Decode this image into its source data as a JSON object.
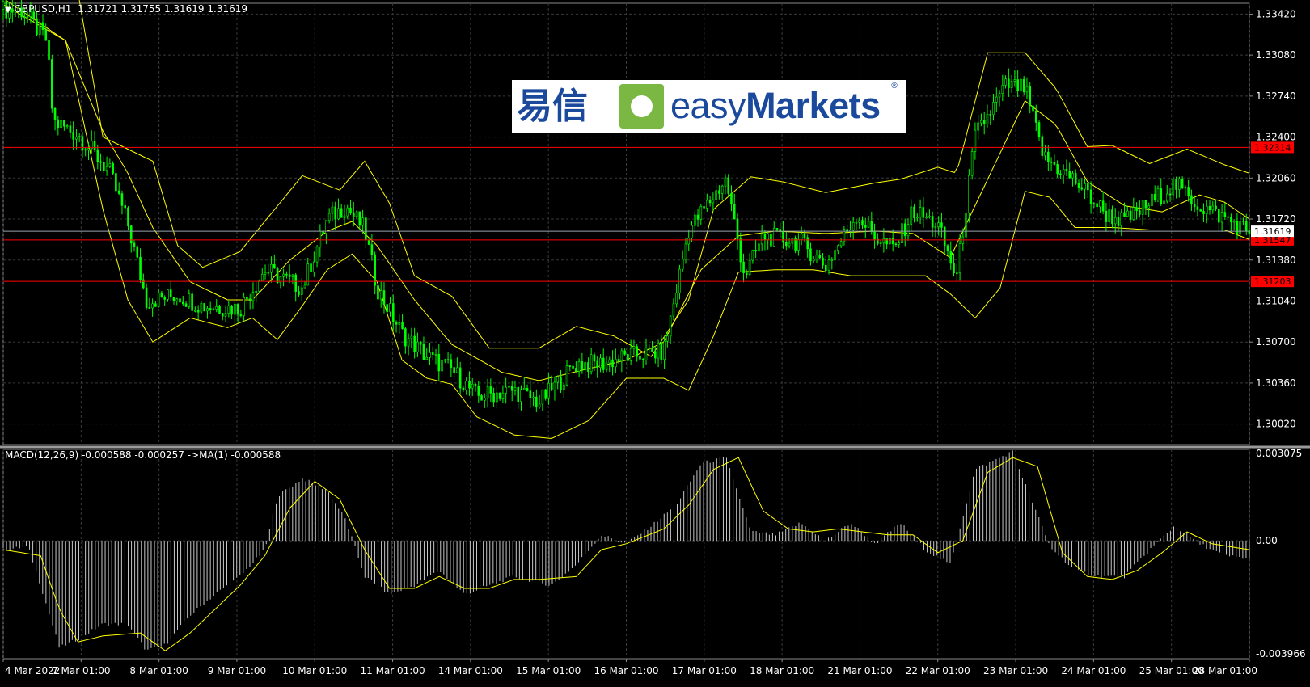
{
  "header": {
    "symbol": "GBPUSD,H1",
    "ohlc": "1.31721 1.31755 1.31619 1.31619",
    "indicator": "MACD(12,26,9) -0.000588 -0.000257  ->MA(1) -0.000588"
  },
  "logo": {
    "chinese": "易信",
    "brand_easy": "easy",
    "brand_markets": "Markets",
    "registered": "®"
  },
  "colors": {
    "background": "#000000",
    "grid": "#3a3a3a",
    "candle": "#00ff00",
    "bands": "#ffff00",
    "histogram": "#c8c8c8",
    "signal": "#ffff00",
    "level_line": "#ff0000",
    "price_tag": "#ffffff",
    "axis_text": "#ffffff"
  },
  "chart_data": [
    {
      "type": "candlestick",
      "title": "GBPUSD,H1",
      "indicators": [
        "Bollinger Bands"
      ],
      "ylim": [
        1.2985,
        1.3351
      ],
      "y_ticks": [
        "1.33420",
        "1.33080",
        "1.32740",
        "1.32400",
        "1.32060",
        "1.31720",
        "1.31380",
        "1.31040",
        "1.30700",
        "1.30360",
        "1.30020"
      ],
      "x_ticks": [
        "4 Mar 2022",
        "7 Mar 01:00",
        "8 Mar 01:00",
        "9 Mar 01:00",
        "10 Mar 01:00",
        "11 Mar 01:00",
        "14 Mar 01:00",
        "15 Mar 01:00",
        "16 Mar 01:00",
        "17 Mar 01:00",
        "18 Mar 01:00",
        "21 Mar 01:00",
        "22 Mar 01:00",
        "23 Mar 01:00",
        "24 Mar 01:00",
        "25 Mar 01:00",
        "28 Mar 01:00"
      ],
      "close_path": [
        [
          0,
          1.3346
        ],
        [
          0.015,
          1.3345
        ],
        [
          0.035,
          1.332
        ],
        [
          0.04,
          1.3253
        ],
        [
          0.06,
          1.3242
        ],
        [
          0.085,
          1.3212
        ],
        [
          0.1,
          1.3168
        ],
        [
          0.115,
          1.3104
        ],
        [
          0.14,
          1.3109
        ],
        [
          0.16,
          1.31
        ],
        [
          0.19,
          1.3098
        ],
        [
          0.21,
          1.313
        ],
        [
          0.24,
          1.3115
        ],
        [
          0.26,
          1.3172
        ],
        [
          0.275,
          1.3183
        ],
        [
          0.29,
          1.3163
        ],
        [
          0.3,
          1.3115
        ],
        [
          0.32,
          1.3077
        ],
        [
          0.34,
          1.3058
        ],
        [
          0.36,
          1.3047
        ],
        [
          0.38,
          1.3025
        ],
        [
          0.41,
          1.303
        ],
        [
          0.43,
          1.302
        ],
        [
          0.46,
          1.3052
        ],
        [
          0.48,
          1.3052
        ],
        [
          0.5,
          1.3058
        ],
        [
          0.53,
          1.3062
        ],
        [
          0.55,
          1.3163
        ],
        [
          0.58,
          1.3205
        ],
        [
          0.595,
          1.3125
        ],
        [
          0.61,
          1.3158
        ],
        [
          0.64,
          1.3153
        ],
        [
          0.66,
          1.3133
        ],
        [
          0.685,
          1.3176
        ],
        [
          0.7,
          1.3157
        ],
        [
          0.715,
          1.3147
        ],
        [
          0.73,
          1.3179
        ],
        [
          0.75,
          1.3167
        ],
        [
          0.765,
          1.3123
        ],
        [
          0.78,
          1.3241
        ],
        [
          0.805,
          1.3283
        ],
        [
          0.82,
          1.328
        ],
        [
          0.835,
          1.3223
        ],
        [
          0.86,
          1.3204
        ],
        [
          0.885,
          1.3176
        ],
        [
          0.9,
          1.317
        ],
        [
          0.92,
          1.3185
        ],
        [
          0.94,
          1.3201
        ],
        [
          0.96,
          1.3183
        ],
        [
          0.98,
          1.3173
        ],
        [
          1,
          1.3162
        ]
      ],
      "bollinger_upper_path": [
        [
          0,
          1.336
        ],
        [
          0.06,
          1.336
        ],
        [
          0.08,
          1.324
        ],
        [
          0.12,
          1.322
        ],
        [
          0.14,
          1.315
        ],
        [
          0.16,
          1.3132
        ],
        [
          0.19,
          1.3145
        ],
        [
          0.24,
          1.3208
        ],
        [
          0.27,
          1.3196
        ],
        [
          0.29,
          1.322
        ],
        [
          0.31,
          1.3185
        ],
        [
          0.33,
          1.3125
        ],
        [
          0.36,
          1.3108
        ],
        [
          0.39,
          1.3065
        ],
        [
          0.43,
          1.3065
        ],
        [
          0.46,
          1.3083
        ],
        [
          0.49,
          1.3075
        ],
        [
          0.52,
          1.3058
        ],
        [
          0.55,
          1.3105
        ],
        [
          0.57,
          1.318
        ],
        [
          0.6,
          1.3207
        ],
        [
          0.625,
          1.3203
        ],
        [
          0.66,
          1.3194
        ],
        [
          0.7,
          1.3202
        ],
        [
          0.72,
          1.3205
        ],
        [
          0.75,
          1.3215
        ],
        [
          0.765,
          1.321
        ],
        [
          0.79,
          1.331
        ],
        [
          0.81,
          1.331
        ],
        [
          0.82,
          1.331
        ],
        [
          0.845,
          1.328
        ],
        [
          0.87,
          1.3232
        ],
        [
          0.89,
          1.3233
        ],
        [
          0.92,
          1.3218
        ],
        [
          0.95,
          1.323
        ],
        [
          0.98,
          1.3217
        ],
        [
          1,
          1.321
        ]
      ],
      "bollinger_middle_path": [
        [
          0,
          1.3355
        ],
        [
          0.05,
          1.332
        ],
        [
          0.08,
          1.3245
        ],
        [
          0.1,
          1.321
        ],
        [
          0.12,
          1.3165
        ],
        [
          0.15,
          1.312
        ],
        [
          0.18,
          1.3105
        ],
        [
          0.2,
          1.3105
        ],
        [
          0.23,
          1.3138
        ],
        [
          0.26,
          1.3162
        ],
        [
          0.28,
          1.317
        ],
        [
          0.3,
          1.315
        ],
        [
          0.33,
          1.3105
        ],
        [
          0.36,
          1.3068
        ],
        [
          0.4,
          1.3045
        ],
        [
          0.43,
          1.3038
        ],
        [
          0.47,
          1.3048
        ],
        [
          0.5,
          1.3055
        ],
        [
          0.53,
          1.307
        ],
        [
          0.56,
          1.313
        ],
        [
          0.59,
          1.3158
        ],
        [
          0.62,
          1.3162
        ],
        [
          0.66,
          1.316
        ],
        [
          0.7,
          1.3162
        ],
        [
          0.73,
          1.316
        ],
        [
          0.76,
          1.314
        ],
        [
          0.79,
          1.3205
        ],
        [
          0.82,
          1.327
        ],
        [
          0.845,
          1.325
        ],
        [
          0.87,
          1.3203
        ],
        [
          0.9,
          1.3183
        ],
        [
          0.93,
          1.3178
        ],
        [
          0.96,
          1.3192
        ],
        [
          0.98,
          1.3186
        ],
        [
          1,
          1.3172
        ]
      ],
      "bollinger_lower_path": [
        [
          0,
          1.335
        ],
        [
          0.05,
          1.332
        ],
        [
          0.08,
          1.318
        ],
        [
          0.1,
          1.3105
        ],
        [
          0.12,
          1.307
        ],
        [
          0.15,
          1.309
        ],
        [
          0.18,
          1.3082
        ],
        [
          0.2,
          1.309
        ],
        [
          0.22,
          1.3072
        ],
        [
          0.24,
          1.31
        ],
        [
          0.26,
          1.313
        ],
        [
          0.28,
          1.3143
        ],
        [
          0.3,
          1.312
        ],
        [
          0.32,
          1.3055
        ],
        [
          0.34,
          1.304
        ],
        [
          0.36,
          1.3035
        ],
        [
          0.38,
          1.3008
        ],
        [
          0.41,
          1.2993
        ],
        [
          0.44,
          1.299
        ],
        [
          0.47,
          1.3005
        ],
        [
          0.5,
          1.304
        ],
        [
          0.53,
          1.304
        ],
        [
          0.55,
          1.303
        ],
        [
          0.57,
          1.3075
        ],
        [
          0.59,
          1.3128
        ],
        [
          0.62,
          1.313
        ],
        [
          0.65,
          1.313
        ],
        [
          0.68,
          1.3125
        ],
        [
          0.71,
          1.3125
        ],
        [
          0.74,
          1.3125
        ],
        [
          0.76,
          1.311
        ],
        [
          0.78,
          1.309
        ],
        [
          0.8,
          1.3115
        ],
        [
          0.82,
          1.3195
        ],
        [
          0.84,
          1.319
        ],
        [
          0.86,
          1.3165
        ],
        [
          0.89,
          1.3165
        ],
        [
          0.92,
          1.3163
        ],
        [
          0.95,
          1.3163
        ],
        [
          0.98,
          1.3163
        ],
        [
          1,
          1.3155
        ]
      ],
      "horizontal_levels": [
        {
          "value": 1.32314,
          "label": "1.32314",
          "color": "#ff0000"
        },
        {
          "value": 1.31547,
          "label": "1.31547",
          "color": "#ff0000"
        },
        {
          "value": 1.31203,
          "label": "1.31203",
          "color": "#ff0000"
        }
      ],
      "last_price": {
        "value": 1.31619,
        "label": "1.31619"
      }
    },
    {
      "type": "histogram",
      "title": "MACD(12,26,9) -0.000588 -0.000257  ->MA(1) -0.000588",
      "ylim": [
        -0.003966,
        0.003075
      ],
      "y_ticks": [
        "0.003075",
        "0.00",
        "-0.003966"
      ],
      "zero_line": 0,
      "histogram_path": [
        [
          0,
          -0.0003
        ],
        [
          0.02,
          -0.0002
        ],
        [
          0.03,
          -0.0015
        ],
        [
          0.045,
          -0.0036
        ],
        [
          0.06,
          -0.0033
        ],
        [
          0.08,
          -0.0028
        ],
        [
          0.1,
          -0.0028
        ],
        [
          0.115,
          -0.0037
        ],
        [
          0.13,
          -0.0035
        ],
        [
          0.15,
          -0.0025
        ],
        [
          0.17,
          -0.0018
        ],
        [
          0.19,
          -0.0012
        ],
        [
          0.21,
          -0.0003
        ],
        [
          0.22,
          0.0015
        ],
        [
          0.24,
          0.0021
        ],
        [
          0.26,
          0.0017
        ],
        [
          0.275,
          0.0007
        ],
        [
          0.29,
          -0.0012
        ],
        [
          0.31,
          -0.0018
        ],
        [
          0.33,
          -0.0015
        ],
        [
          0.35,
          -0.001
        ],
        [
          0.37,
          -0.0018
        ],
        [
          0.39,
          -0.0015
        ],
        [
          0.41,
          -0.0012
        ],
        [
          0.44,
          -0.0015
        ],
        [
          0.46,
          -0.0008
        ],
        [
          0.48,
          0.0002
        ],
        [
          0.5,
          -0.0001
        ],
        [
          0.52,
          0.0005
        ],
        [
          0.54,
          0.0012
        ],
        [
          0.56,
          0.0026
        ],
        [
          0.58,
          0.0028
        ],
        [
          0.6,
          0.0003
        ],
        [
          0.62,
          0.0002
        ],
        [
          0.64,
          0.0006
        ],
        [
          0.66,
          0.0
        ],
        [
          0.68,
          0.0006
        ],
        [
          0.7,
          -0.0001
        ],
        [
          0.72,
          0.0006
        ],
        [
          0.74,
          -0.0003
        ],
        [
          0.76,
          -0.0008
        ],
        [
          0.78,
          0.0024
        ],
        [
          0.81,
          0.003
        ],
        [
          0.84,
          -0.0002
        ],
        [
          0.86,
          -0.001
        ],
        [
          0.88,
          -0.0012
        ],
        [
          0.9,
          -0.0012
        ],
        [
          0.92,
          -0.0003
        ],
        [
          0.94,
          0.0005
        ],
        [
          0.96,
          -0.0001
        ],
        [
          0.98,
          -0.0005
        ],
        [
          1,
          -0.0006
        ]
      ],
      "signal_path": [
        [
          0,
          -0.0003
        ],
        [
          0.03,
          -0.0005
        ],
        [
          0.045,
          -0.0023
        ],
        [
          0.06,
          -0.0034
        ],
        [
          0.08,
          -0.0032
        ],
        [
          0.11,
          -0.0031
        ],
        [
          0.13,
          -0.0037
        ],
        [
          0.15,
          -0.0031
        ],
        [
          0.17,
          -0.0023
        ],
        [
          0.19,
          -0.0015
        ],
        [
          0.21,
          -0.0005
        ],
        [
          0.23,
          0.0011
        ],
        [
          0.25,
          0.002
        ],
        [
          0.27,
          0.0014
        ],
        [
          0.29,
          -0.0003
        ],
        [
          0.31,
          -0.0016
        ],
        [
          0.33,
          -0.0016
        ],
        [
          0.35,
          -0.0012
        ],
        [
          0.37,
          -0.0016
        ],
        [
          0.39,
          -0.0016
        ],
        [
          0.41,
          -0.0013
        ],
        [
          0.43,
          -0.0013
        ],
        [
          0.46,
          -0.0012
        ],
        [
          0.48,
          -0.0003
        ],
        [
          0.5,
          -0.0001
        ],
        [
          0.53,
          0.0004
        ],
        [
          0.55,
          0.0012
        ],
        [
          0.57,
          0.0024
        ],
        [
          0.59,
          0.0028
        ],
        [
          0.61,
          0.001
        ],
        [
          0.63,
          0.0004
        ],
        [
          0.65,
          0.0003
        ],
        [
          0.67,
          0.0004
        ],
        [
          0.69,
          0.0003
        ],
        [
          0.71,
          0.0002
        ],
        [
          0.73,
          0.0002
        ],
        [
          0.75,
          -0.0004
        ],
        [
          0.77,
          0.0
        ],
        [
          0.79,
          0.0023
        ],
        [
          0.81,
          0.0028
        ],
        [
          0.83,
          0.0025
        ],
        [
          0.85,
          -0.0004
        ],
        [
          0.87,
          -0.0012
        ],
        [
          0.89,
          -0.0013
        ],
        [
          0.91,
          -0.001
        ],
        [
          0.93,
          -0.0004
        ],
        [
          0.95,
          0.0003
        ],
        [
          0.97,
          -0.0001
        ],
        [
          1,
          -0.0003
        ]
      ]
    }
  ]
}
